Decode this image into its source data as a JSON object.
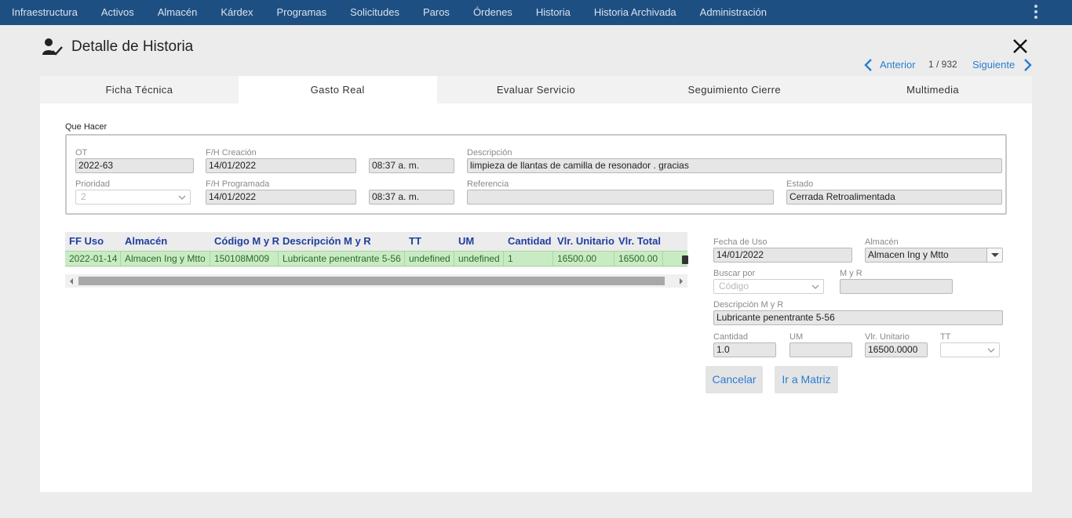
{
  "nav": {
    "items": [
      "Infraestructura",
      "Activos",
      "Almacén",
      "Kárdex",
      "Programas",
      "Solicitudes",
      "Paros",
      "Órdenes",
      "Historia",
      "Historia Archivada",
      "Administración"
    ]
  },
  "header": {
    "title": "Detalle de Historia",
    "icon": "user-check-icon",
    "pager": {
      "prev_label": "Anterior",
      "count": "1 / 932",
      "next_label": "Siguiente"
    }
  },
  "tabs": [
    {
      "label": "Ficha Técnica",
      "active": false
    },
    {
      "label": "Gasto Real",
      "active": true
    },
    {
      "label": "Evaluar Servicio",
      "active": false
    },
    {
      "label": "Seguimiento Cierre",
      "active": false
    },
    {
      "label": "Multimedia",
      "active": false
    }
  ],
  "que_hacer": {
    "section_label": "Que Hacer",
    "ot": {
      "label": "OT",
      "value": "2022-63"
    },
    "fh_creacion": {
      "label": "F/H Creación",
      "date": "14/01/2022",
      "time": "08:37 a. m."
    },
    "descripcion": {
      "label": "Descripción",
      "value": "limpieza de llantas de camilla de resonador . gracias"
    },
    "prioridad": {
      "label": "Prioridad",
      "value": "2"
    },
    "fh_programada": {
      "label": "F/H Programada",
      "date": "14/01/2022",
      "time": "08:37 a. m."
    },
    "referencia": {
      "label": "Referencia",
      "value": ""
    },
    "estado": {
      "label": "Estado",
      "value": "Cerrada Retroalimentada"
    }
  },
  "grid": {
    "columns": [
      "FF Uso",
      "Almacén",
      "Código M y R",
      "Descripción M y R",
      "TT",
      "UM",
      "Cantidad",
      "Vlr. Unitario",
      "Vlr. Total"
    ],
    "rows": [
      [
        "2022-01-14",
        "Almacen Ing y Mtto",
        "150108M009",
        "Lubricante penentrante 5-56",
        "undefined",
        "undefined",
        "1",
        "16500.00",
        "16500.00"
      ]
    ]
  },
  "form": {
    "fecha_uso": {
      "label": "Fecha de Uso",
      "value": "14/01/2022"
    },
    "almacen": {
      "label": "Almacén",
      "value": "Almacen Ing y Mtto"
    },
    "buscar_por": {
      "label": "Buscar por",
      "placeholder": "Código"
    },
    "myr": {
      "label": "M y R",
      "value": ""
    },
    "descripcion_myr": {
      "label": "Descripción M y R",
      "value": "Lubricante penentrante 5-56"
    },
    "cantidad": {
      "label": "Cantidad",
      "value": "1.0"
    },
    "um": {
      "label": "UM",
      "value": ""
    },
    "vlr_unitario": {
      "label": "Vlr. Unitario",
      "value": "16500.0000"
    },
    "tt": {
      "label": "TT",
      "value": ""
    },
    "cancel_label": "Cancelar",
    "matrix_label": "Ir a Matriz"
  },
  "colors": {
    "nav_bg": "#1e4f82",
    "link": "#2d7bd4",
    "grid_header": "#1f3f9e",
    "row_selected": "#c9ebc3"
  }
}
